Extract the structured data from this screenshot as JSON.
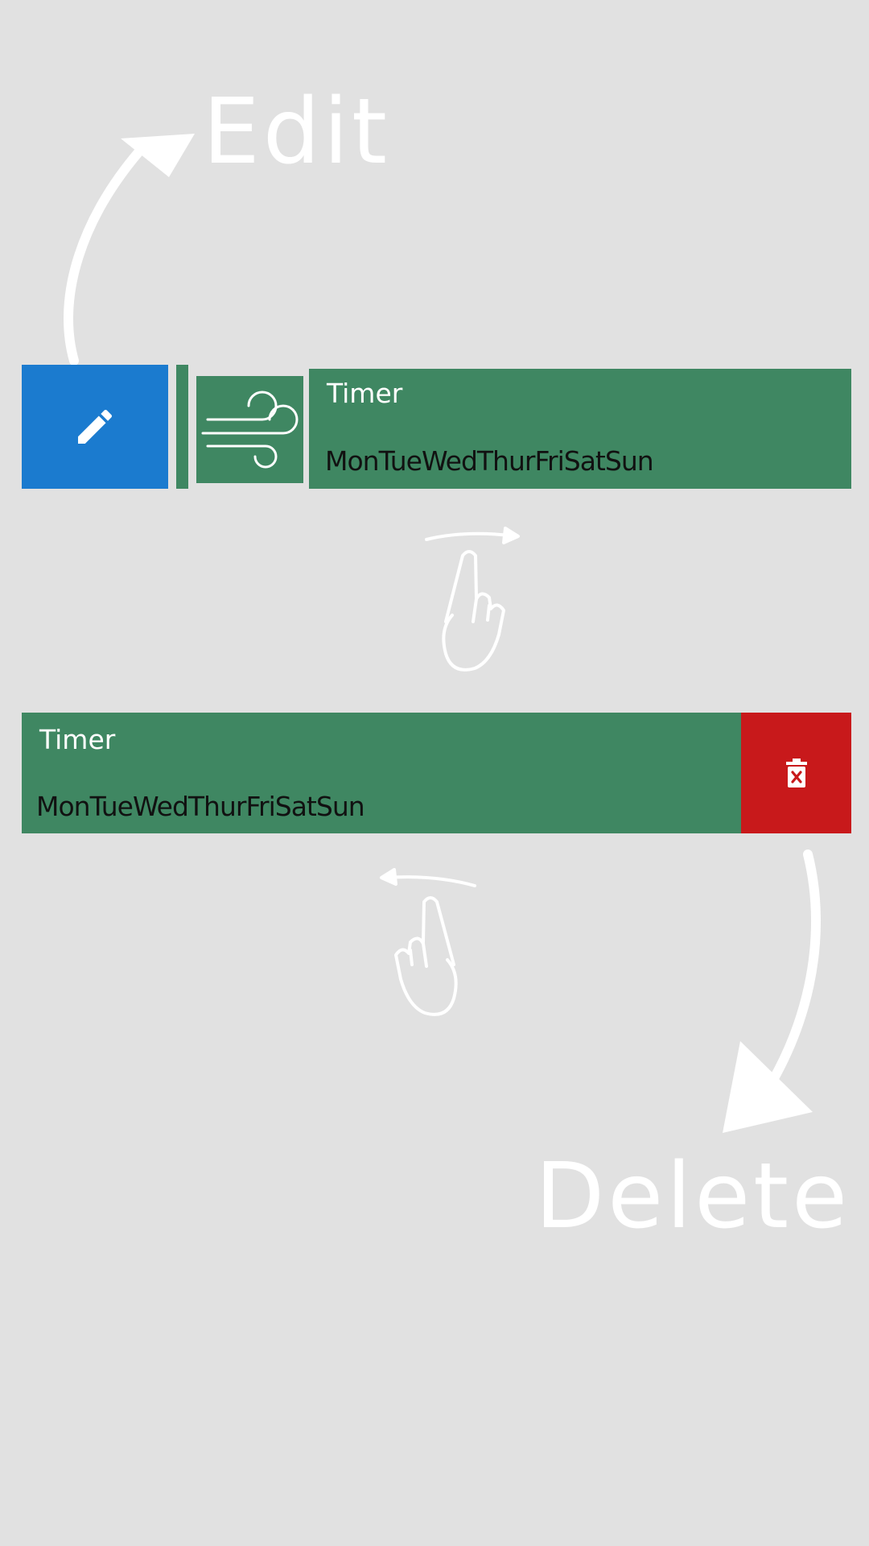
{
  "hints": {
    "edit_label": "Edit",
    "delete_label": "Delete"
  },
  "swiped_right_item": {
    "title": "Timer",
    "days": "MonTueWedThurFriSatSun",
    "icon": "wind-icon",
    "action_icon": "pencil-icon"
  },
  "swiped_left_item": {
    "title": "Timer",
    "days": "MonTueWedThurFriSatSun",
    "action_icon": "trash-x-icon"
  },
  "colors": {
    "background": "#e1e1e1",
    "item_green": "#3f8762",
    "edit_blue": "#1b7bcf",
    "delete_red": "#c8191b",
    "hint_white": "#ffffff"
  }
}
